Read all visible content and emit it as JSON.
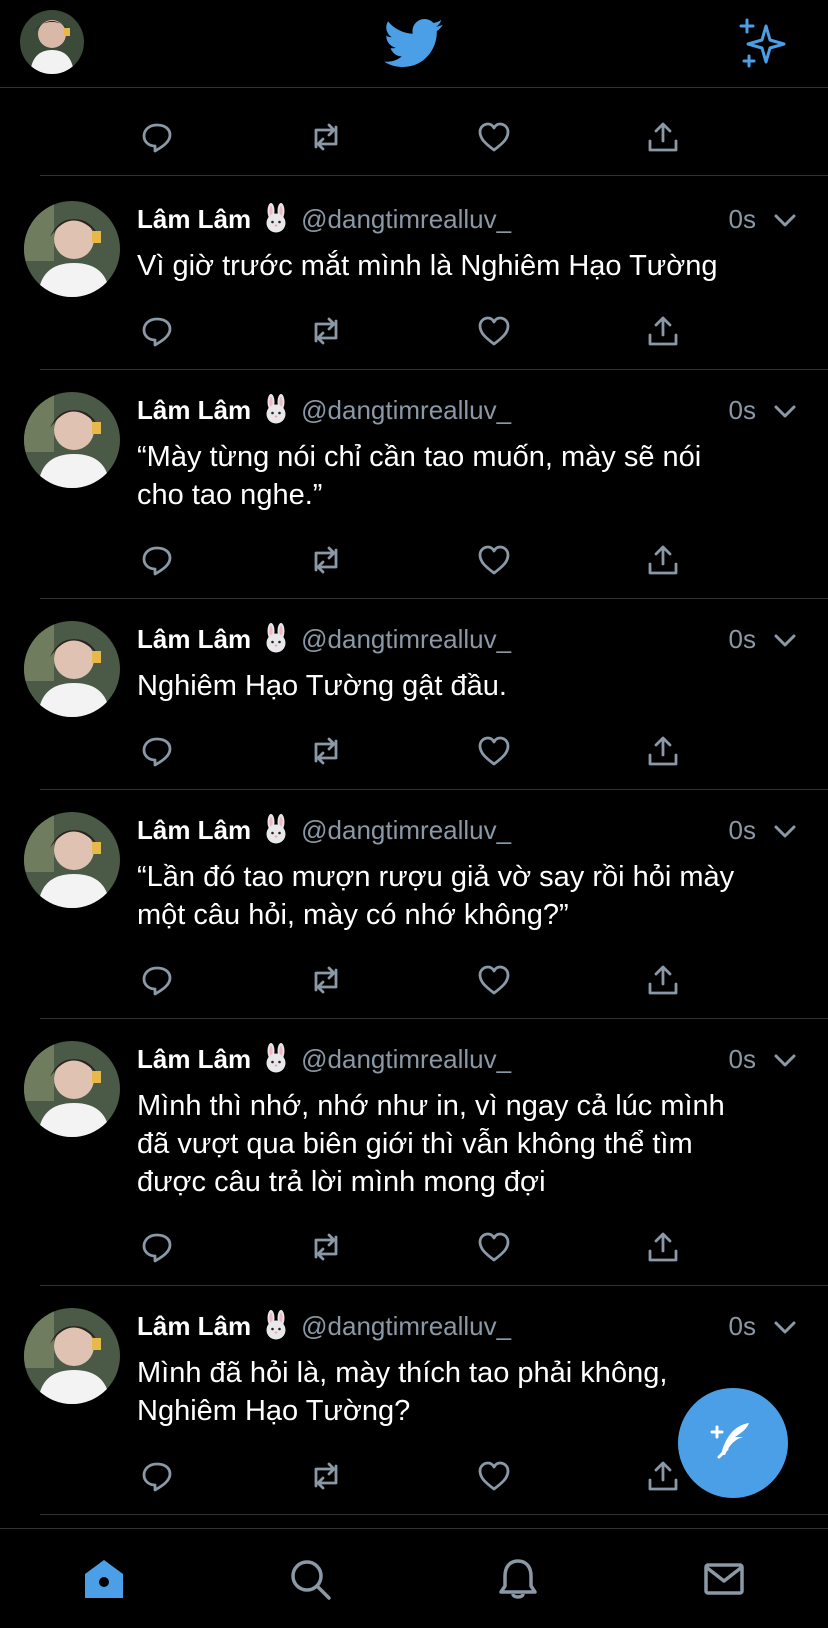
{
  "header": {
    "avatar_icon": "profile-avatar",
    "logo_icon": "twitter-bird-icon",
    "sparkle_icon": "sparkle-icon"
  },
  "tweets": [
    {
      "name": "Lâm Lâm",
      "handle": "@dangtimrealluv_",
      "time": "0s",
      "lines": [
        "Vì giờ trước mắt mình là Nghiêm Hạo Tường"
      ]
    },
    {
      "name": "Lâm Lâm",
      "handle": "@dangtimrealluv_",
      "time": "0s",
      "lines": [
        "“Mày từng nói chỉ cần tao muốn, mày sẽ nói",
        "cho tao nghe.”"
      ]
    },
    {
      "name": "Lâm Lâm",
      "handle": "@dangtimrealluv_",
      "time": "0s",
      "lines": [
        "Nghiêm Hạo Tường gật đầu."
      ]
    },
    {
      "name": "Lâm Lâm",
      "handle": "@dangtimrealluv_",
      "time": "0s",
      "lines": [
        "“Lần đó tao mượn rượu giả vờ say rồi hỏi mày",
        "một câu hỏi, mày có nhớ không?”"
      ]
    },
    {
      "name": "Lâm Lâm",
      "handle": "@dangtimrealluv_",
      "time": "0s",
      "lines": [
        "Mình thì nhớ, nhớ như in, vì ngay cả lúc mình",
        "đã vượt qua biên giới thì vẫn không thể tìm",
        "được câu trả lời mình mong đợi"
      ]
    },
    {
      "name": "Lâm Lâm",
      "handle": "@dangtimrealluv_",
      "time": "0s",
      "lines": [
        "Mình đã hỏi là, mày thích tao phải không,",
        "Nghiêm Hạo Tường?"
      ]
    }
  ],
  "colors": {
    "accent": "#4a9fe7",
    "background": "#000000",
    "secondary_text": "#8b98a5",
    "divider": "#2f3336"
  },
  "tabs": [
    "home-icon",
    "search-icon",
    "bell-icon",
    "mail-icon"
  ],
  "compose_icon": "compose-tweet-icon"
}
